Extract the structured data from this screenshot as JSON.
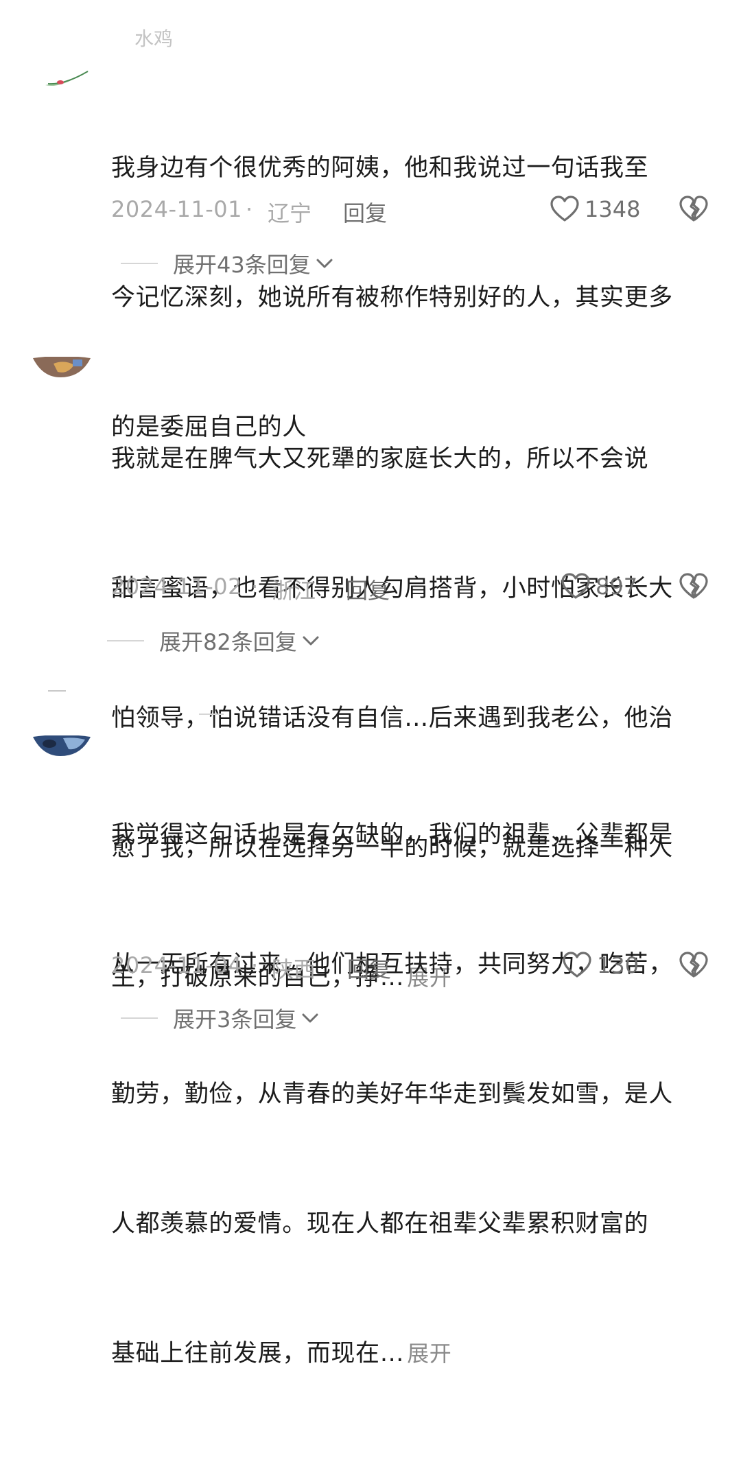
{
  "top_partial_username": "水鸡",
  "comments": [
    {
      "lines": [
        "我身边有个很优秀的阿姨，他和我说过一句话我至",
        "今记忆深刻，她说所有被称作特别好的人，其实更多",
        "的是委屈自己的人"
      ],
      "expand_label": "",
      "date": "2024-11-01",
      "region": "辽宁",
      "reply_label": "回复",
      "likes": "1348",
      "replies_label": "展开43条回复"
    },
    {
      "lines": [
        "我就是在脾气大又死犟的家庭长大的，所以不会说",
        "甜言蜜语，也看不得别人勾肩搭背，小时怕家长长大",
        "怕领导，怕说错话没有自信…后来遇到我老公，他治",
        "愈了我，所以在选择另一半的时候，就是选择一种人",
        "生，打破原来的自己，挣…"
      ],
      "expand_label": "展开",
      "date": "2024-11-02",
      "region": "浙江",
      "reply_label": "回复",
      "likes": "897",
      "replies_label": "展开82条回复"
    },
    {
      "lines": [
        "我觉得这句话也是有欠缺的，我们的祖辈，父辈都是",
        "从一无所有过来，他们相互扶持，共同努力，吃苦，",
        "勤劳，勤俭，从青春的美好年华走到鬓发如雪，是人",
        "人都羡慕的爱情。现在人都在祖辈父辈累积财富的",
        "基础上往前发展，而现在…"
      ],
      "expand_label": "展开",
      "date": "2024-11-04",
      "region": "陕西",
      "reply_label": "回复",
      "likes": "130",
      "replies_label": "展开3条回复"
    }
  ],
  "colors": {
    "text_primary": "#1c1c1c",
    "text_meta": "#a9a9a9",
    "text_action": "#6f6f6f",
    "divider": "#d6d6d6"
  },
  "icons": {
    "like": "heart-outline-icon",
    "dislike": "broken-heart-icon",
    "expand": "chevron-down-icon"
  }
}
